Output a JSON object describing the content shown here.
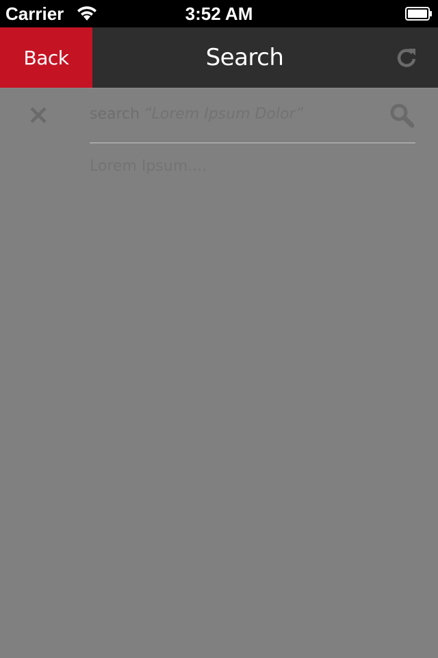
{
  "status_bar": {
    "carrier": "Carrier",
    "time": "3:52 AM",
    "wifi_icon": "wifi-icon",
    "battery_icon": "battery-icon"
  },
  "nav_bar": {
    "back_label": "Back",
    "title": "Search",
    "refresh_icon": "refresh-icon",
    "back_color": "#c41424",
    "bar_color": "#2e2e2e"
  },
  "search": {
    "prefix": "search",
    "query": "“Lorem Ipsum Dolor”",
    "close_icon": "close-icon",
    "search_icon": "search-icon"
  },
  "results": [
    {
      "label": "Lorem Ipsum...."
    }
  ],
  "colors": {
    "overlay_background": "#808080"
  }
}
